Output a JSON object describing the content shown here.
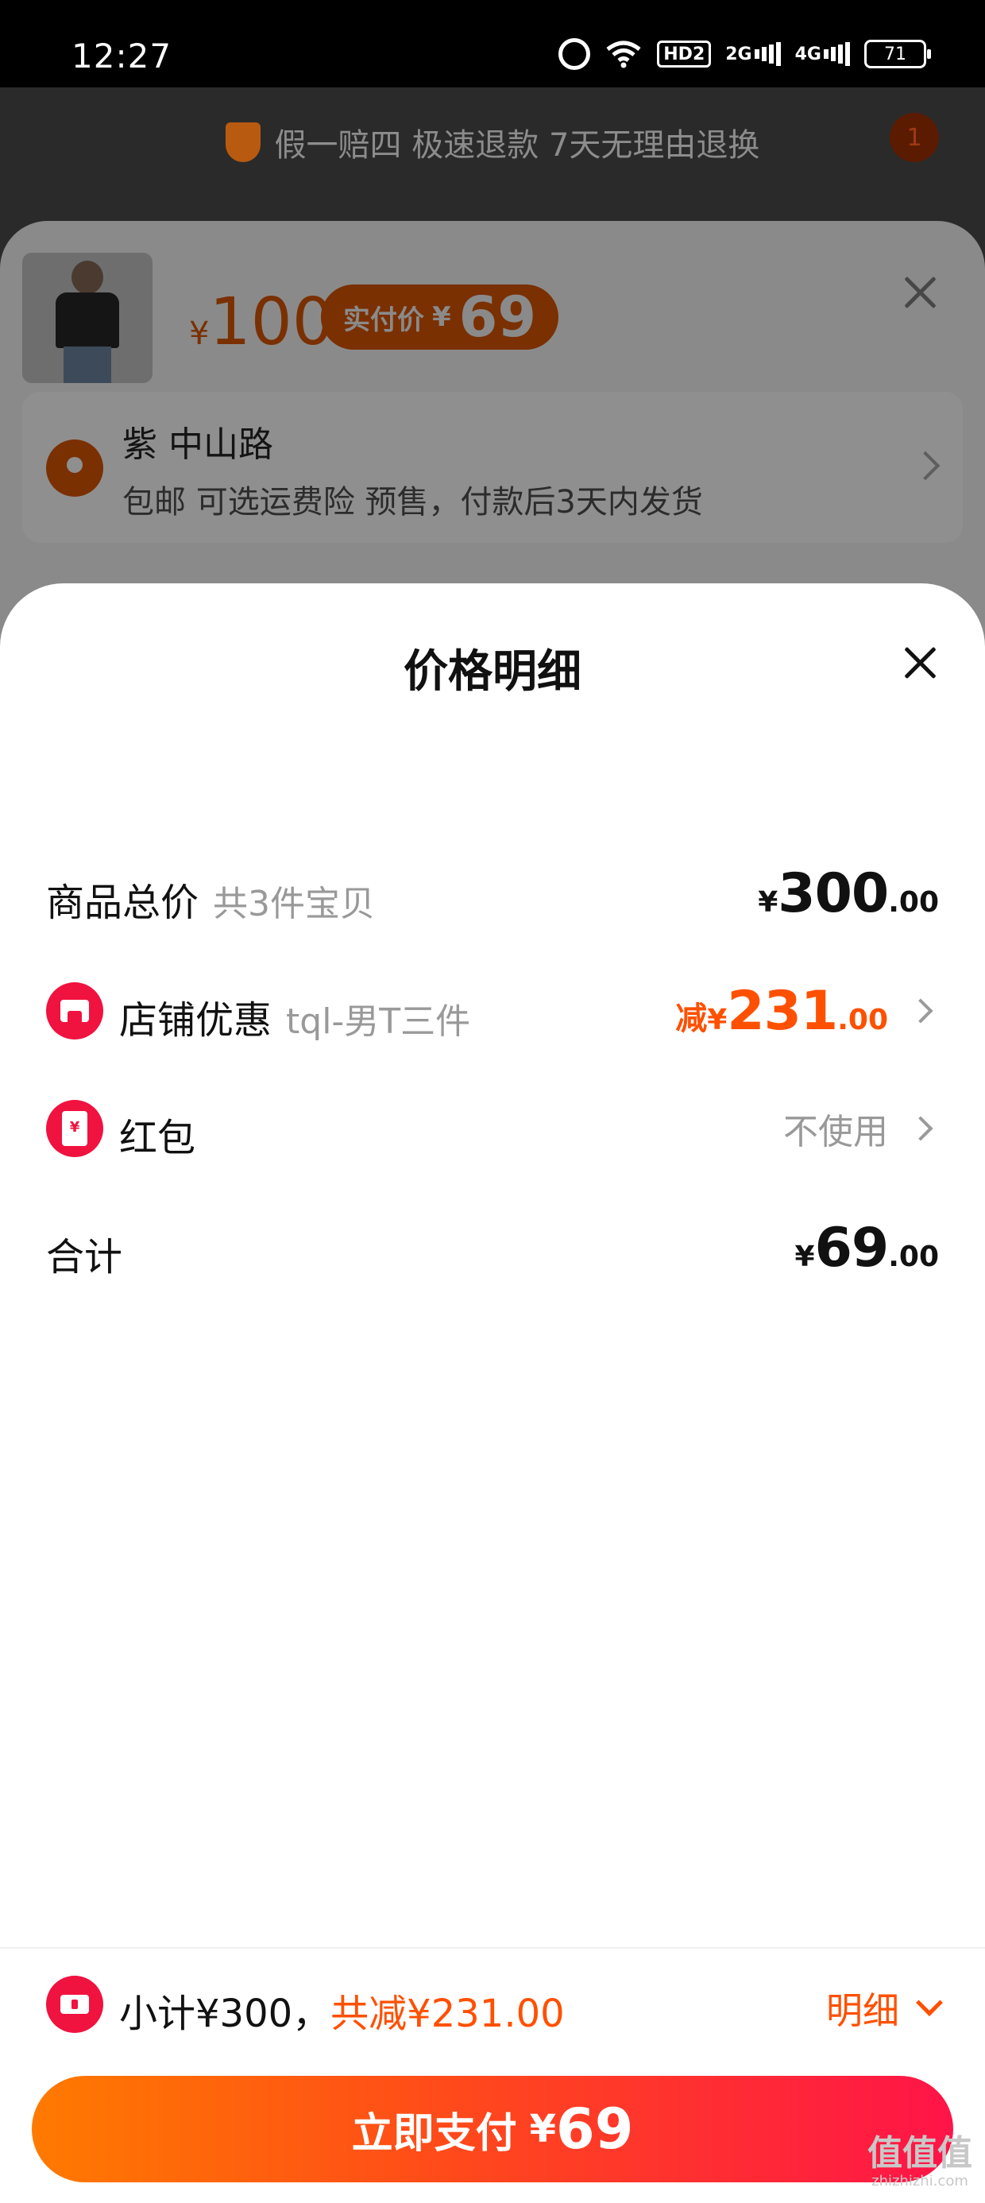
{
  "status_bar": {
    "time": "12:27",
    "hd_label": "HD2",
    "net_2g": "2G",
    "net_4g": "4G",
    "battery": "71"
  },
  "background": {
    "guarantee_text": "假一赔四 极速退款 7天无理由退换",
    "badge_count": "1",
    "sku": {
      "price_currency": "¥",
      "price": "100",
      "actual_label": "实付价",
      "actual_currency": "¥",
      "actual_price": "69"
    },
    "address": {
      "title": "紫 中山路",
      "subtitle": "包邮  可选运费险  预售，付款后3天内发货"
    }
  },
  "sheet": {
    "title": "价格明细",
    "rows": [
      {
        "label": "商品总价",
        "note": "共3件宝贝",
        "currency": "¥",
        "amount": "300",
        "cents": ".00"
      },
      {
        "label": "店铺优惠",
        "note": "tql-男T三件",
        "prefix": "减",
        "currency": "¥",
        "amount": "231",
        "cents": ".00",
        "icon": "store-icon"
      },
      {
        "label": "红包",
        "value": "不使用",
        "icon": "red-packet-icon"
      },
      {
        "label": "合计",
        "currency": "¥",
        "amount": "69",
        "cents": ".00"
      }
    ]
  },
  "footer": {
    "subtotal_text": "小计¥300，",
    "discount_text": "共减¥231.00",
    "detail_label": "明细",
    "pay_label": "立即支付",
    "pay_currency": "¥",
    "pay_amount": "69"
  },
  "watermark": {
    "line1": "值值值",
    "line2": "zhizhizhi.com"
  },
  "colors": {
    "accent": "#ff5000",
    "red": "#f0123f",
    "pay_gradient_start": "#ff7a00",
    "pay_gradient_end": "#ff1448"
  }
}
